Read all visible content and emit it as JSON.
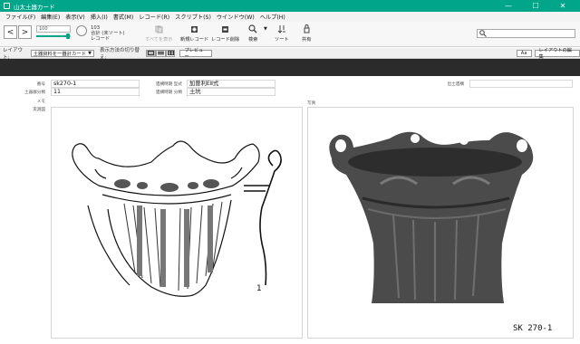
{
  "window": {
    "title": "山太土器カード",
    "controls": [
      "—",
      "☐",
      "✕"
    ]
  },
  "menu": [
    "ファイル(F)",
    "編集(E)",
    "表示(V)",
    "挿入(I)",
    "書式(M)",
    "レコード(R)",
    "スクリプト(S)",
    "ウインドウ(W)",
    "ヘルプ(H)"
  ],
  "toolbar": {
    "prev": "<",
    "next": ">",
    "record_number": "100",
    "record_slider_fraction": 0.92,
    "total": "103",
    "total_status": "合計 (未ソート)",
    "record_unit": "レコード",
    "show_all": "すべてを表示",
    "new_record": "新規レコード",
    "delete_record": "レコード削除",
    "find": "検索",
    "sort": "ソート",
    "share": "共有",
    "search_placeholder": ""
  },
  "layout_bar": {
    "layout_label": "レイアウト:",
    "layout_value": "土器資料を一器計カード",
    "view_label": "表示方法の切り替え:",
    "preview": "プレビュー",
    "aa": "Aa",
    "edit_layout": "レイアウトの編集"
  },
  "record": {
    "labels": {
      "number": "番号",
      "excavation_div": "土器群分類",
      "memo": "メモ",
      "survey": "実測図",
      "period_style": "遺構時期 型式",
      "period_class": "遺構時期 分類",
      "feature": "出土遺構",
      "photo": "写真"
    },
    "number": "sk270-1",
    "excavation_div": "11",
    "style": "加曽利EⅡ式",
    "class": "土坑",
    "feature": "",
    "drawing_number": "1",
    "photo_caption": "SK 270-1"
  },
  "colors": {
    "titlebar": "#00a58a",
    "accent": "#00a58a",
    "dark_band": "#2b2b2b"
  }
}
